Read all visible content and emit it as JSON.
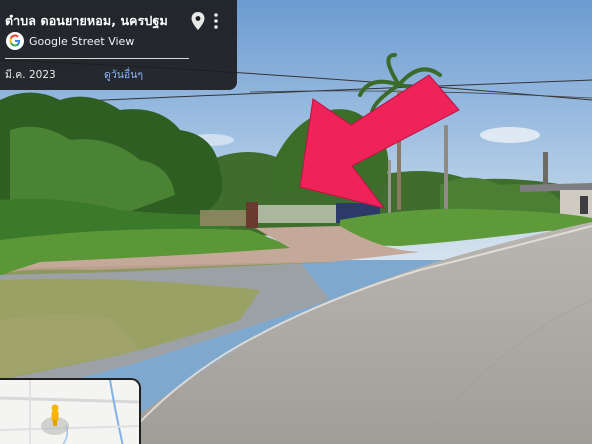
{
  "info_card": {
    "place_title": "ตำบล ดอนยายหอม, นครปฐม",
    "provider": "Google Street View",
    "capture_date": "มี.ค. 2023",
    "see_more": "ดูวันอื่นๆ"
  },
  "icons": {
    "pin": "location-pin-icon",
    "more": "more-vert-icon",
    "logo": "google-g-logo"
  },
  "colors": {
    "card_bg": "#1c1c1e",
    "link": "#8ab4f8",
    "arrow": "#f0225a"
  }
}
